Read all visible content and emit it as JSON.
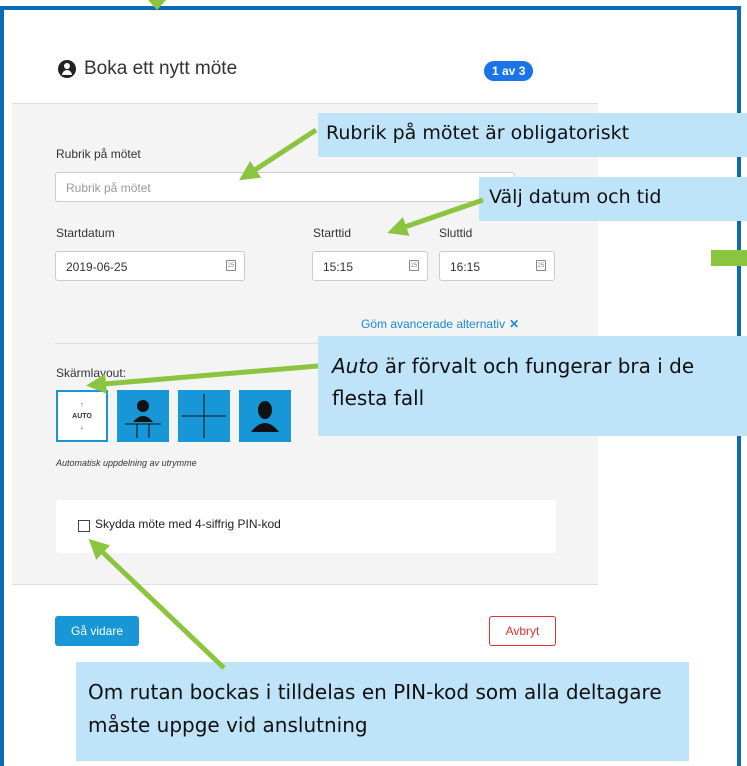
{
  "header": {
    "title": "Boka ett nytt möte",
    "step_badge": "1 av 3",
    "icon": "user-circle-icon"
  },
  "form": {
    "subject": {
      "label": "Rubrik på mötet",
      "placeholder": "Rubrik på mötet"
    },
    "start_date": {
      "label": "Startdatum",
      "value": "2019-06-25"
    },
    "start_time": {
      "label": "Starttid",
      "value": "15:15"
    },
    "end_time": {
      "label": "Sluttid",
      "value": "16:15"
    },
    "advanced_link": "Göm avancerade alternativ",
    "advanced_close": "✕",
    "screen_layout": {
      "label": "Skärmlayout:",
      "auto_text": "AUTO",
      "caption": "Automatisk uppdelning av utrymme",
      "options": [
        "auto",
        "speaker-grid",
        "grid",
        "speaker"
      ]
    },
    "pin": {
      "label": "Skydda möte med 4-siffrig PIN-kod",
      "checked": false
    }
  },
  "buttons": {
    "next": "Gå vidare",
    "cancel": "Avbryt"
  },
  "callouts": {
    "subject": "Rubrik på mötet är obligatoriskt",
    "datetime": "Välj datum och tid",
    "layout_em": "Auto",
    "layout_rest": " är förvalt och fungerar bra i de flesta fall",
    "pin": "Om rutan bockas i tilldelas en PIN-kod som alla deltagare måste uppge vid anslutning"
  },
  "colors": {
    "accent": "#1796d8",
    "frame": "#0b6bb6",
    "callout_bg": "#bfe3f8",
    "arrow": "#8bc43f",
    "cancel": "#dd3333"
  }
}
